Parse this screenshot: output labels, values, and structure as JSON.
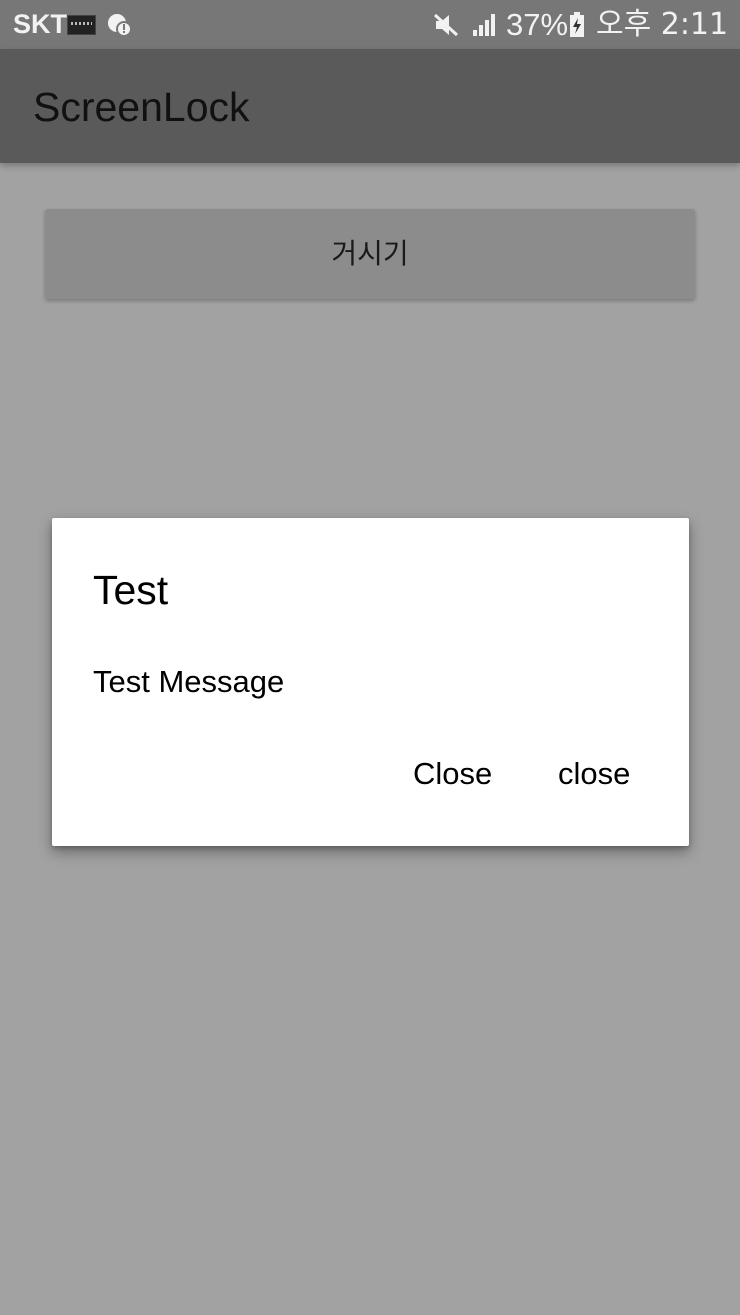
{
  "status_bar": {
    "carrier": "SKT",
    "battery_percent": "37%",
    "time": "오후 2:11",
    "icons": [
      "sim-card-icon",
      "alert-icon",
      "mute-icon",
      "signal-icon",
      "battery-charging-icon"
    ]
  },
  "app_bar": {
    "title": "ScreenLock"
  },
  "main": {
    "button_label": "거시기"
  },
  "dialog": {
    "title": "Test",
    "message": "Test Message",
    "buttons": [
      "Close",
      "close"
    ]
  },
  "colors": {
    "status_bar": "#777777",
    "app_bar": "#5a5a5a",
    "scrim_background": "#a2a2a2",
    "button": "#8c8c8c",
    "dialog": "#ffffff"
  }
}
